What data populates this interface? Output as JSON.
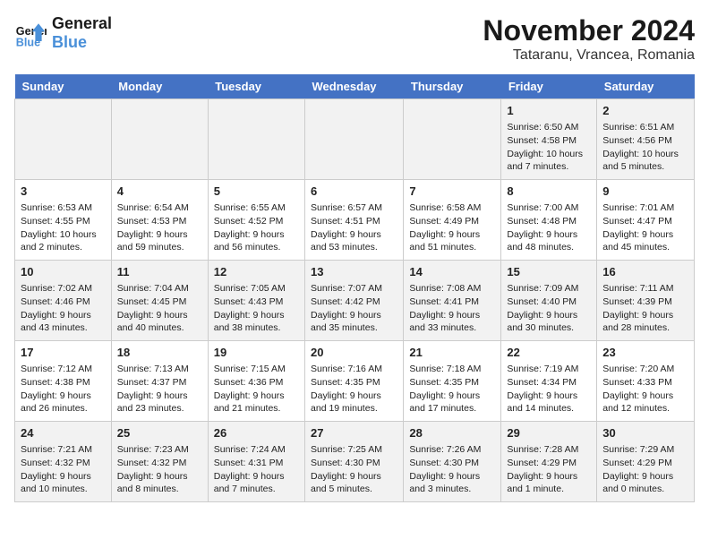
{
  "header": {
    "logo_line1": "General",
    "logo_line2": "Blue",
    "month": "November 2024",
    "location": "Tataranu, Vrancea, Romania"
  },
  "weekdays": [
    "Sunday",
    "Monday",
    "Tuesday",
    "Wednesday",
    "Thursday",
    "Friday",
    "Saturday"
  ],
  "weeks": [
    [
      {
        "day": "",
        "info": ""
      },
      {
        "day": "",
        "info": ""
      },
      {
        "day": "",
        "info": ""
      },
      {
        "day": "",
        "info": ""
      },
      {
        "day": "",
        "info": ""
      },
      {
        "day": "1",
        "info": "Sunrise: 6:50 AM\nSunset: 4:58 PM\nDaylight: 10 hours and 7 minutes."
      },
      {
        "day": "2",
        "info": "Sunrise: 6:51 AM\nSunset: 4:56 PM\nDaylight: 10 hours and 5 minutes."
      }
    ],
    [
      {
        "day": "3",
        "info": "Sunrise: 6:53 AM\nSunset: 4:55 PM\nDaylight: 10 hours and 2 minutes."
      },
      {
        "day": "4",
        "info": "Sunrise: 6:54 AM\nSunset: 4:53 PM\nDaylight: 9 hours and 59 minutes."
      },
      {
        "day": "5",
        "info": "Sunrise: 6:55 AM\nSunset: 4:52 PM\nDaylight: 9 hours and 56 minutes."
      },
      {
        "day": "6",
        "info": "Sunrise: 6:57 AM\nSunset: 4:51 PM\nDaylight: 9 hours and 53 minutes."
      },
      {
        "day": "7",
        "info": "Sunrise: 6:58 AM\nSunset: 4:49 PM\nDaylight: 9 hours and 51 minutes."
      },
      {
        "day": "8",
        "info": "Sunrise: 7:00 AM\nSunset: 4:48 PM\nDaylight: 9 hours and 48 minutes."
      },
      {
        "day": "9",
        "info": "Sunrise: 7:01 AM\nSunset: 4:47 PM\nDaylight: 9 hours and 45 minutes."
      }
    ],
    [
      {
        "day": "10",
        "info": "Sunrise: 7:02 AM\nSunset: 4:46 PM\nDaylight: 9 hours and 43 minutes."
      },
      {
        "day": "11",
        "info": "Sunrise: 7:04 AM\nSunset: 4:45 PM\nDaylight: 9 hours and 40 minutes."
      },
      {
        "day": "12",
        "info": "Sunrise: 7:05 AM\nSunset: 4:43 PM\nDaylight: 9 hours and 38 minutes."
      },
      {
        "day": "13",
        "info": "Sunrise: 7:07 AM\nSunset: 4:42 PM\nDaylight: 9 hours and 35 minutes."
      },
      {
        "day": "14",
        "info": "Sunrise: 7:08 AM\nSunset: 4:41 PM\nDaylight: 9 hours and 33 minutes."
      },
      {
        "day": "15",
        "info": "Sunrise: 7:09 AM\nSunset: 4:40 PM\nDaylight: 9 hours and 30 minutes."
      },
      {
        "day": "16",
        "info": "Sunrise: 7:11 AM\nSunset: 4:39 PM\nDaylight: 9 hours and 28 minutes."
      }
    ],
    [
      {
        "day": "17",
        "info": "Sunrise: 7:12 AM\nSunset: 4:38 PM\nDaylight: 9 hours and 26 minutes."
      },
      {
        "day": "18",
        "info": "Sunrise: 7:13 AM\nSunset: 4:37 PM\nDaylight: 9 hours and 23 minutes."
      },
      {
        "day": "19",
        "info": "Sunrise: 7:15 AM\nSunset: 4:36 PM\nDaylight: 9 hours and 21 minutes."
      },
      {
        "day": "20",
        "info": "Sunrise: 7:16 AM\nSunset: 4:35 PM\nDaylight: 9 hours and 19 minutes."
      },
      {
        "day": "21",
        "info": "Sunrise: 7:18 AM\nSunset: 4:35 PM\nDaylight: 9 hours and 17 minutes."
      },
      {
        "day": "22",
        "info": "Sunrise: 7:19 AM\nSunset: 4:34 PM\nDaylight: 9 hours and 14 minutes."
      },
      {
        "day": "23",
        "info": "Sunrise: 7:20 AM\nSunset: 4:33 PM\nDaylight: 9 hours and 12 minutes."
      }
    ],
    [
      {
        "day": "24",
        "info": "Sunrise: 7:21 AM\nSunset: 4:32 PM\nDaylight: 9 hours and 10 minutes."
      },
      {
        "day": "25",
        "info": "Sunrise: 7:23 AM\nSunset: 4:32 PM\nDaylight: 9 hours and 8 minutes."
      },
      {
        "day": "26",
        "info": "Sunrise: 7:24 AM\nSunset: 4:31 PM\nDaylight: 9 hours and 7 minutes."
      },
      {
        "day": "27",
        "info": "Sunrise: 7:25 AM\nSunset: 4:30 PM\nDaylight: 9 hours and 5 minutes."
      },
      {
        "day": "28",
        "info": "Sunrise: 7:26 AM\nSunset: 4:30 PM\nDaylight: 9 hours and 3 minutes."
      },
      {
        "day": "29",
        "info": "Sunrise: 7:28 AM\nSunset: 4:29 PM\nDaylight: 9 hours and 1 minute."
      },
      {
        "day": "30",
        "info": "Sunrise: 7:29 AM\nSunset: 4:29 PM\nDaylight: 9 hours and 0 minutes."
      }
    ]
  ]
}
